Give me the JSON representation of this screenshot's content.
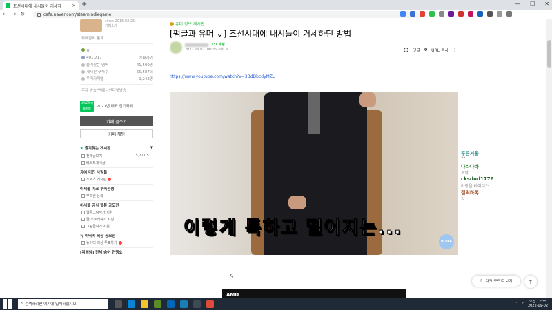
{
  "browser": {
    "tab_title": "조선시대에 내시들이 거세하",
    "tab_close": "×",
    "new_tab": "+",
    "url": "cafe.naver.com/steamindiegame",
    "window_buttons": [
      "—",
      "☐",
      "✕"
    ],
    "nav_back": "←",
    "nav_forward": "→",
    "nav_reload": "↻"
  },
  "sidebar": {
    "since": "since 2015.02.25.",
    "cafe_intro": "카페소개",
    "manage": "카페관리",
    "stats": "통계",
    "level": "숲",
    "level_user": "401.717",
    "invite": "초대하기",
    "stats_rows": [
      {
        "label": "즐겨찾는 멤버",
        "value": "41,509명"
      },
      {
        "label": "게시판 구독수",
        "value": "65,587회"
      },
      {
        "label": "우리카페앱",
        "value": "9,243명"
      }
    ],
    "topic": "주제 방송/연예 › 인터넷방송",
    "badge_text": "NAVER 대표카페",
    "badge_label": "2021년 대표 인기카페",
    "write_button": "카페 글쓰기",
    "chat_button": "카페 채팅",
    "favorites_head": "즐겨찾는 게시판",
    "favorites_toggle": "▼",
    "favorites": [
      {
        "label": "전체글보기",
        "count": "5,771,571"
      },
      {
        "label": "베스트게시글",
        "count": ""
      }
    ],
    "sections": [
      {
        "title": "공예 미친 사람들",
        "items": [
          "스포츠 게시판"
        ]
      },
      {
        "title": "이세돌 마크 부족전쟁",
        "items": [
          "부족원 등록"
        ]
      },
      {
        "title": "이세돌 공식 웹툰 공모전",
        "items": [
          "웹툰그림작가 지원",
          "글/스토리작가 지원",
          "그림글작가 지원"
        ]
      },
      {
        "title": "뉴 이터바 의상 공모전",
        "items": [
          "뉴이터 의상 투표하기"
        ]
      },
      {
        "title": "[왁헤임] 전체 숨어 연맹소",
        "items": []
      }
    ]
  },
  "article": {
    "breadcrumb": "유머 정보 게시판",
    "title": "[펌글과 유머 ⌄] 조선시대에 내시들이 거세하던 방법",
    "author_grade": "1:1 채팅",
    "date": "2022.09.02. 00:35",
    "views": "조회 9",
    "comment_label": "댓글",
    "comment_count": "0",
    "url_copy": "URL 복사",
    "more": "⋮",
    "link": "https://www.youtube.com/watch?v=3BdDbcdyMZU",
    "subtitle_white_1": "이렇게 ",
    "subtitle_red": "툭하고 ",
    "subtitle_white_2": "떨어지는...",
    "watermark": "BODA",
    "ad_text": "AMD"
  },
  "chat": [
    {
      "name": "푸른거울",
      "msg": "??",
      "color": "#2e8b8b"
    },
    {
      "name": "다라다라",
      "msg": "오약",
      "color": "#2e7d32"
    },
    {
      "name": "cksdud1776",
      "msg": "",
      "color": "#1b5e20"
    },
    {
      "name": "",
      "msg": "아랑을 레이더스",
      "color": "#888"
    },
    {
      "name": "갤럭하록",
      "msg": "익",
      "color": "#a0522d"
    }
  ],
  "floating": {
    "darkmode": "다크 모드로 보기",
    "totop": "↑"
  },
  "taskbar": {
    "search_placeholder": "검색하려면 여기에 입력하십시오.",
    "time": "오전 12:35",
    "date": "2022-09-02"
  }
}
